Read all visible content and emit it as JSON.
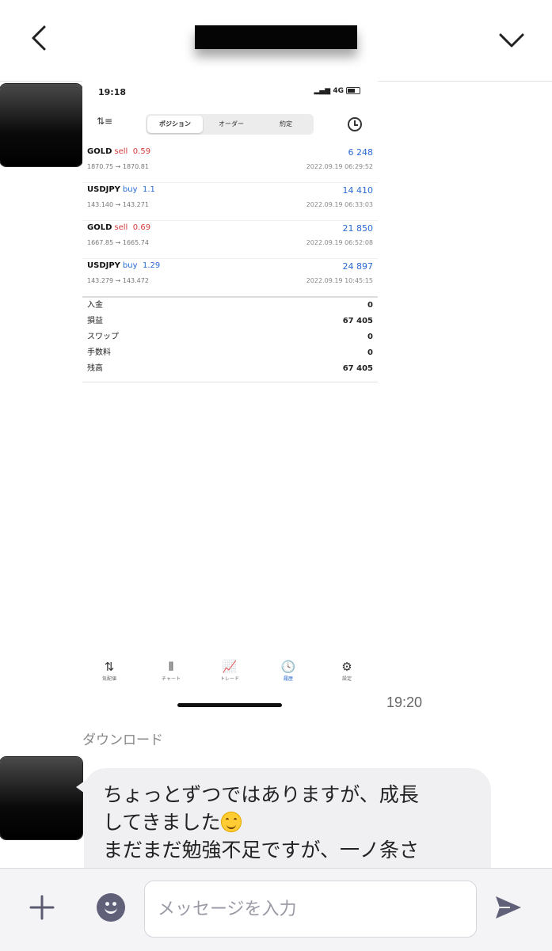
{
  "screenshot": {
    "status_time": "19:18",
    "status_right": "4G",
    "tabs": [
      "ポジション",
      "オーダー",
      "約定"
    ],
    "active_tab_index": 0,
    "positions": [
      {
        "symbol": "GOLD",
        "side": "sell",
        "lots": "0.59",
        "prices": "1870.75 → 1870.81",
        "profit": "6 248",
        "date": "2022.09.19 06:29:52"
      },
      {
        "symbol": "USDJPY",
        "side": "buy",
        "lots": "1.1",
        "prices": "143.140 → 143.271",
        "profit": "14 410",
        "date": "2022.09.19 06:33:03"
      },
      {
        "symbol": "GOLD",
        "side": "sell",
        "lots": "0.69",
        "prices": "1667.85 → 1665.74",
        "profit": "21 850",
        "date": "2022.09.19 06:52:08"
      },
      {
        "symbol": "USDJPY",
        "side": "buy",
        "lots": "1.29",
        "prices": "143.279 → 143.472",
        "profit": "24 897",
        "date": "2022.09.19 10:45:15"
      }
    ],
    "summary": [
      {
        "label": "入金",
        "value": "0"
      },
      {
        "label": "損益",
        "value": "67 405"
      },
      {
        "label": "スワップ",
        "value": "0"
      },
      {
        "label": "手数料",
        "value": "0"
      },
      {
        "label": "残高",
        "value": "67 405"
      }
    ],
    "nav": [
      {
        "label": "気配値",
        "icon": "⇅"
      },
      {
        "label": "チャート",
        "icon": "⫴"
      },
      {
        "label": "トレード",
        "icon": "📈"
      },
      {
        "label": "履歴",
        "icon": "🕓"
      },
      {
        "label": "設定",
        "icon": "⚙"
      }
    ],
    "active_nav_index": 3
  },
  "chat": {
    "time": "19:20",
    "download_label": "ダウンロード",
    "message_line1": "ちょっとずつではありますが、成長",
    "message_line2": "してきました",
    "message_line3": "まだまだ勉強不足ですが、一ノ条さ"
  },
  "input": {
    "placeholder": "メッセージを入力",
    "value": ""
  }
}
